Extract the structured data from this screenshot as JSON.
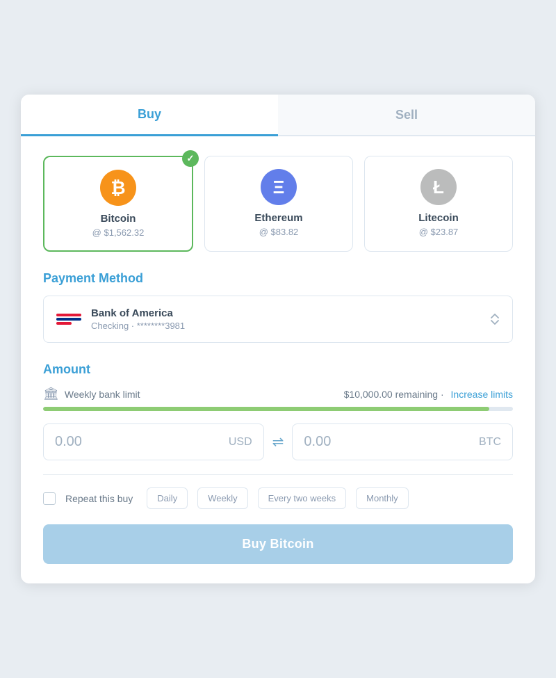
{
  "tabs": [
    {
      "id": "buy",
      "label": "Buy",
      "active": true
    },
    {
      "id": "sell",
      "label": "Sell",
      "active": false
    }
  ],
  "cryptos": [
    {
      "id": "btc",
      "name": "Bitcoin",
      "price": "@ $1,562.32",
      "selected": true,
      "symbol": "₿",
      "colorClass": "btc"
    },
    {
      "id": "eth",
      "name": "Ethereum",
      "price": "@ $83.82",
      "selected": false,
      "symbol": "Ξ",
      "colorClass": "eth"
    },
    {
      "id": "ltc",
      "name": "Litecoin",
      "price": "@ $23.87",
      "selected": false,
      "symbol": "Ł",
      "colorClass": "ltc"
    }
  ],
  "payment_section": {
    "title": "Payment Method",
    "bank_name": "Bank of America",
    "bank_account": "Checking · ********3981"
  },
  "amount_section": {
    "title": "Amount",
    "limit_label": "Weekly bank limit",
    "limit_remaining": "$10,000.00 remaining",
    "limit_separator": "·",
    "increase_limits": "Increase limits",
    "progress_percent": 95,
    "usd_value": "0.00",
    "usd_currency": "USD",
    "btc_value": "0.00",
    "btc_currency": "BTC"
  },
  "repeat": {
    "label": "Repeat this buy",
    "frequencies": [
      "Daily",
      "Weekly",
      "Every two weeks",
      "Monthly"
    ]
  },
  "buy_button": "Buy Bitcoin"
}
